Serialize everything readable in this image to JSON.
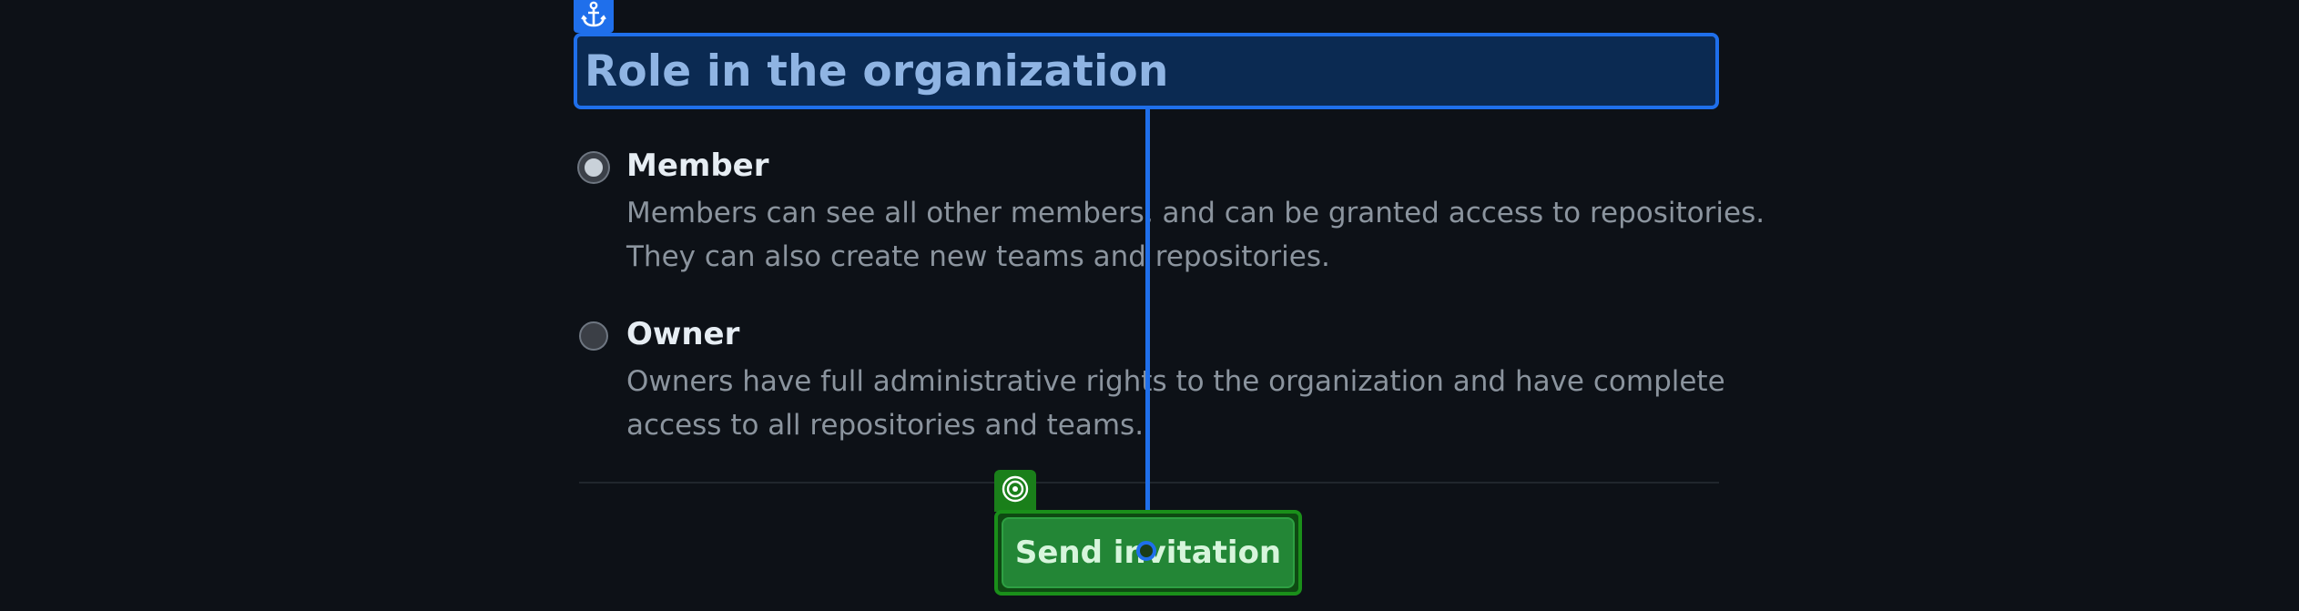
{
  "section": {
    "title": "Role in the organization"
  },
  "roles": [
    {
      "label": "Member",
      "checked": true,
      "description_lines": [
        "Members can see all other members, and can be granted access to repositories.",
        "They can also create new teams and repositories."
      ]
    },
    {
      "label": "Owner",
      "checked": false,
      "description_lines": [
        "Owners have full administrative rights to the organization and have complete",
        "access to all repositories and teams."
      ]
    }
  ],
  "actions": {
    "send_label": "Send invitation"
  },
  "colors": {
    "background": "#0d1117",
    "highlight_blue": "#1f6feb",
    "button_green": "#238636",
    "target_green": "#1a7f1a"
  },
  "icons": {
    "anchor": "anchor-icon",
    "target": "target-icon"
  }
}
